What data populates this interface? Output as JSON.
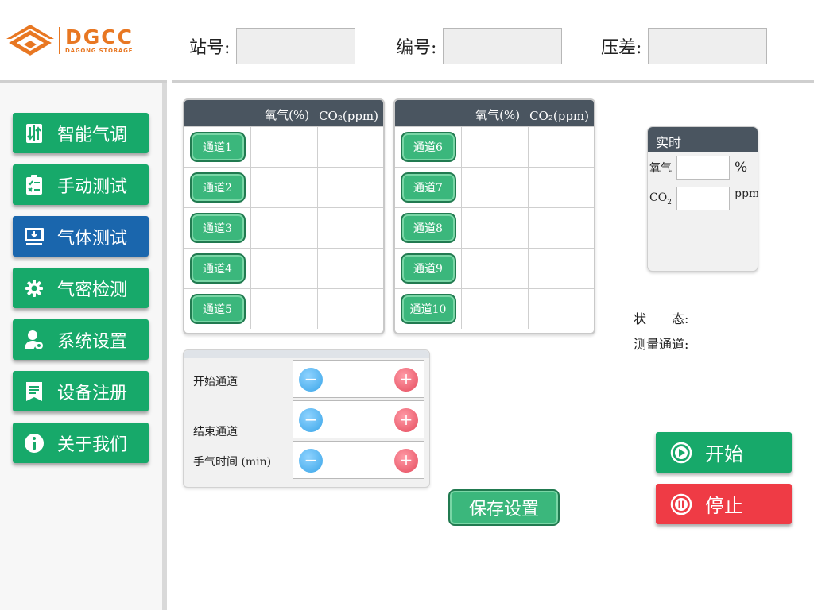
{
  "brand": {
    "name": "DGCC",
    "tagline": "DAGONG STORAGE",
    "color": "#e87722"
  },
  "header": {
    "station_label": "站号:",
    "station_value": "",
    "serial_label": "编号:",
    "serial_value": "",
    "pressure_label": "压差:",
    "pressure_value": ""
  },
  "sidebar": {
    "items": [
      {
        "label": "智能气调",
        "icon": "sort-arrows-icon",
        "active": false
      },
      {
        "label": "手动测试",
        "icon": "clipboard-checklist-icon",
        "active": false
      },
      {
        "label": "气体测试",
        "icon": "monitor-download-icon",
        "active": true
      },
      {
        "label": "气密检测",
        "icon": "gear-icon",
        "active": false
      },
      {
        "label": "系统设置",
        "icon": "user-settings-icon",
        "active": false
      },
      {
        "label": "设备注册",
        "icon": "list-document-icon",
        "active": false
      },
      {
        "label": "关于我们",
        "icon": "info-icon",
        "active": false
      }
    ],
    "colors": {
      "normal": "#17a96a",
      "active": "#1a66ad"
    }
  },
  "channels": {
    "col_oxygen": "氧气(%)",
    "col_co2": "CO₂(ppm)",
    "left": [
      {
        "name": "通道1",
        "oxygen": "",
        "co2": ""
      },
      {
        "name": "通道2",
        "oxygen": "",
        "co2": ""
      },
      {
        "name": "通道3",
        "oxygen": "",
        "co2": ""
      },
      {
        "name": "通道4",
        "oxygen": "",
        "co2": ""
      },
      {
        "name": "通道5",
        "oxygen": "",
        "co2": ""
      }
    ],
    "right": [
      {
        "name": "通道6",
        "oxygen": "",
        "co2": ""
      },
      {
        "name": "通道7",
        "oxygen": "",
        "co2": ""
      },
      {
        "name": "通道8",
        "oxygen": "",
        "co2": ""
      },
      {
        "name": "通道9",
        "oxygen": "",
        "co2": ""
      },
      {
        "name": "通道10",
        "oxygen": "",
        "co2": ""
      }
    ]
  },
  "settings": {
    "start_channel_label": "开始通道",
    "start_channel_value": "",
    "end_channel_label": "结束通道",
    "end_channel_value": "",
    "sample_time_label": "手气时间 (min)",
    "sample_time_value": "",
    "minus": "−",
    "plus": "+"
  },
  "save_label": "保存设置",
  "realtime": {
    "title": "实时",
    "oxygen_label": "氧气",
    "oxygen_value": "",
    "oxygen_unit": "%",
    "co2_label": "CO",
    "co2_sub": "2",
    "co2_value": "",
    "co2_unit": "ppm"
  },
  "status": {
    "state_label": "状　　态:",
    "state_value": "",
    "channel_label": "测量通道:",
    "channel_value": ""
  },
  "actions": {
    "start_label": "开始",
    "stop_label": "停止",
    "start_color": "#17a96a",
    "stop_color": "#ef3b45"
  }
}
